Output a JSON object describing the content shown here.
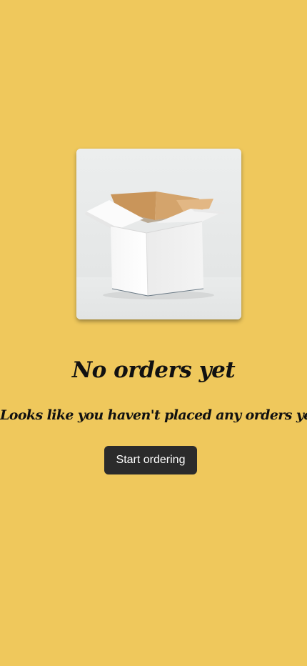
{
  "empty_state": {
    "image_icon": "open-cardboard-box",
    "title": "No orders yet",
    "message": "Looks like you haven't placed any orders yet.",
    "cta_label": "Start ordering"
  },
  "colors": {
    "background": "#efc85c",
    "button_background": "#2b2b2b",
    "button_text": "#ffffff",
    "text": "#111111"
  }
}
